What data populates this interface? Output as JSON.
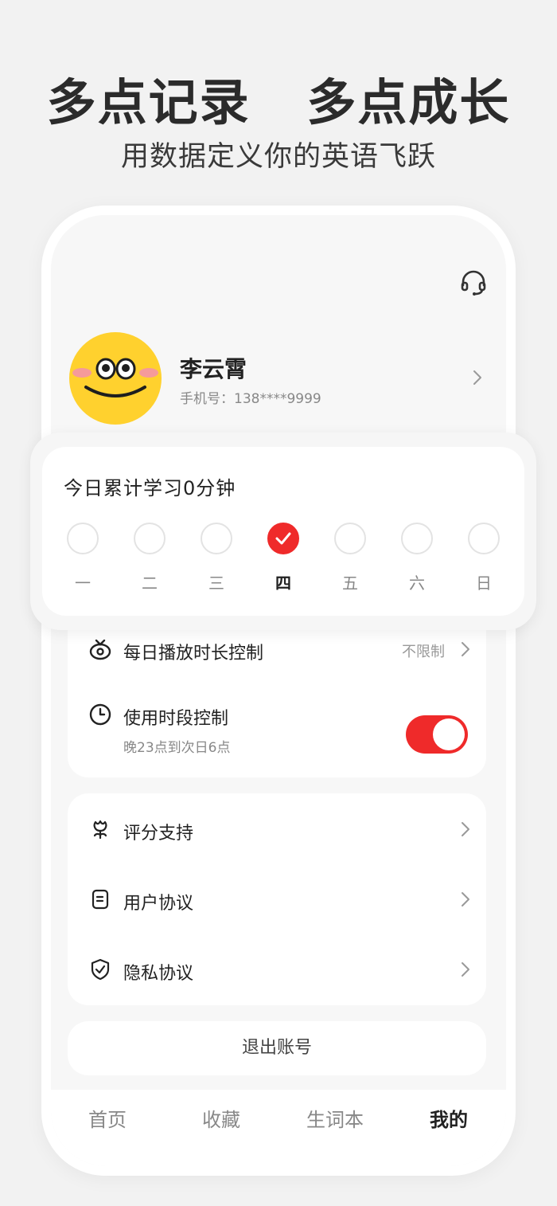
{
  "promo": {
    "headline": "多点记录   多点成长",
    "subline": "用数据定义你的英语飞跃"
  },
  "profile": {
    "name": "李云霄",
    "phone": "手机号：138****9999",
    "support_icon": "headset-icon",
    "avatar_icon": "smiley-face-avatar"
  },
  "study": {
    "title": "今日累计学习0分钟",
    "days": [
      {
        "label": "一",
        "checked": false
      },
      {
        "label": "二",
        "checked": false
      },
      {
        "label": "三",
        "checked": false
      },
      {
        "label": "四",
        "checked": true
      },
      {
        "label": "五",
        "checked": false
      },
      {
        "label": "六",
        "checked": false
      },
      {
        "label": "日",
        "checked": false
      }
    ]
  },
  "controls": {
    "daily_limit": {
      "label": "每日播放时长控制",
      "value": "不限制",
      "icon": "tv-icon"
    },
    "time_period": {
      "label": "使用时段控制",
      "sub": "晚23点到次日6点",
      "icon": "clock-icon",
      "enabled": true
    }
  },
  "menu": [
    {
      "label": "评分支持",
      "icon": "flower-icon"
    },
    {
      "label": "用户协议",
      "icon": "document-icon"
    },
    {
      "label": "隐私协议",
      "icon": "shield-icon"
    }
  ],
  "logout": {
    "label": "退出账号"
  },
  "tabs": [
    {
      "label": "首页",
      "active": false
    },
    {
      "label": "收藏",
      "active": false
    },
    {
      "label": "生词本",
      "active": false
    },
    {
      "label": "我的",
      "active": true
    }
  ],
  "colors": {
    "accent": "#ef2a2a",
    "avatar_yellow": "#ffd12e"
  }
}
